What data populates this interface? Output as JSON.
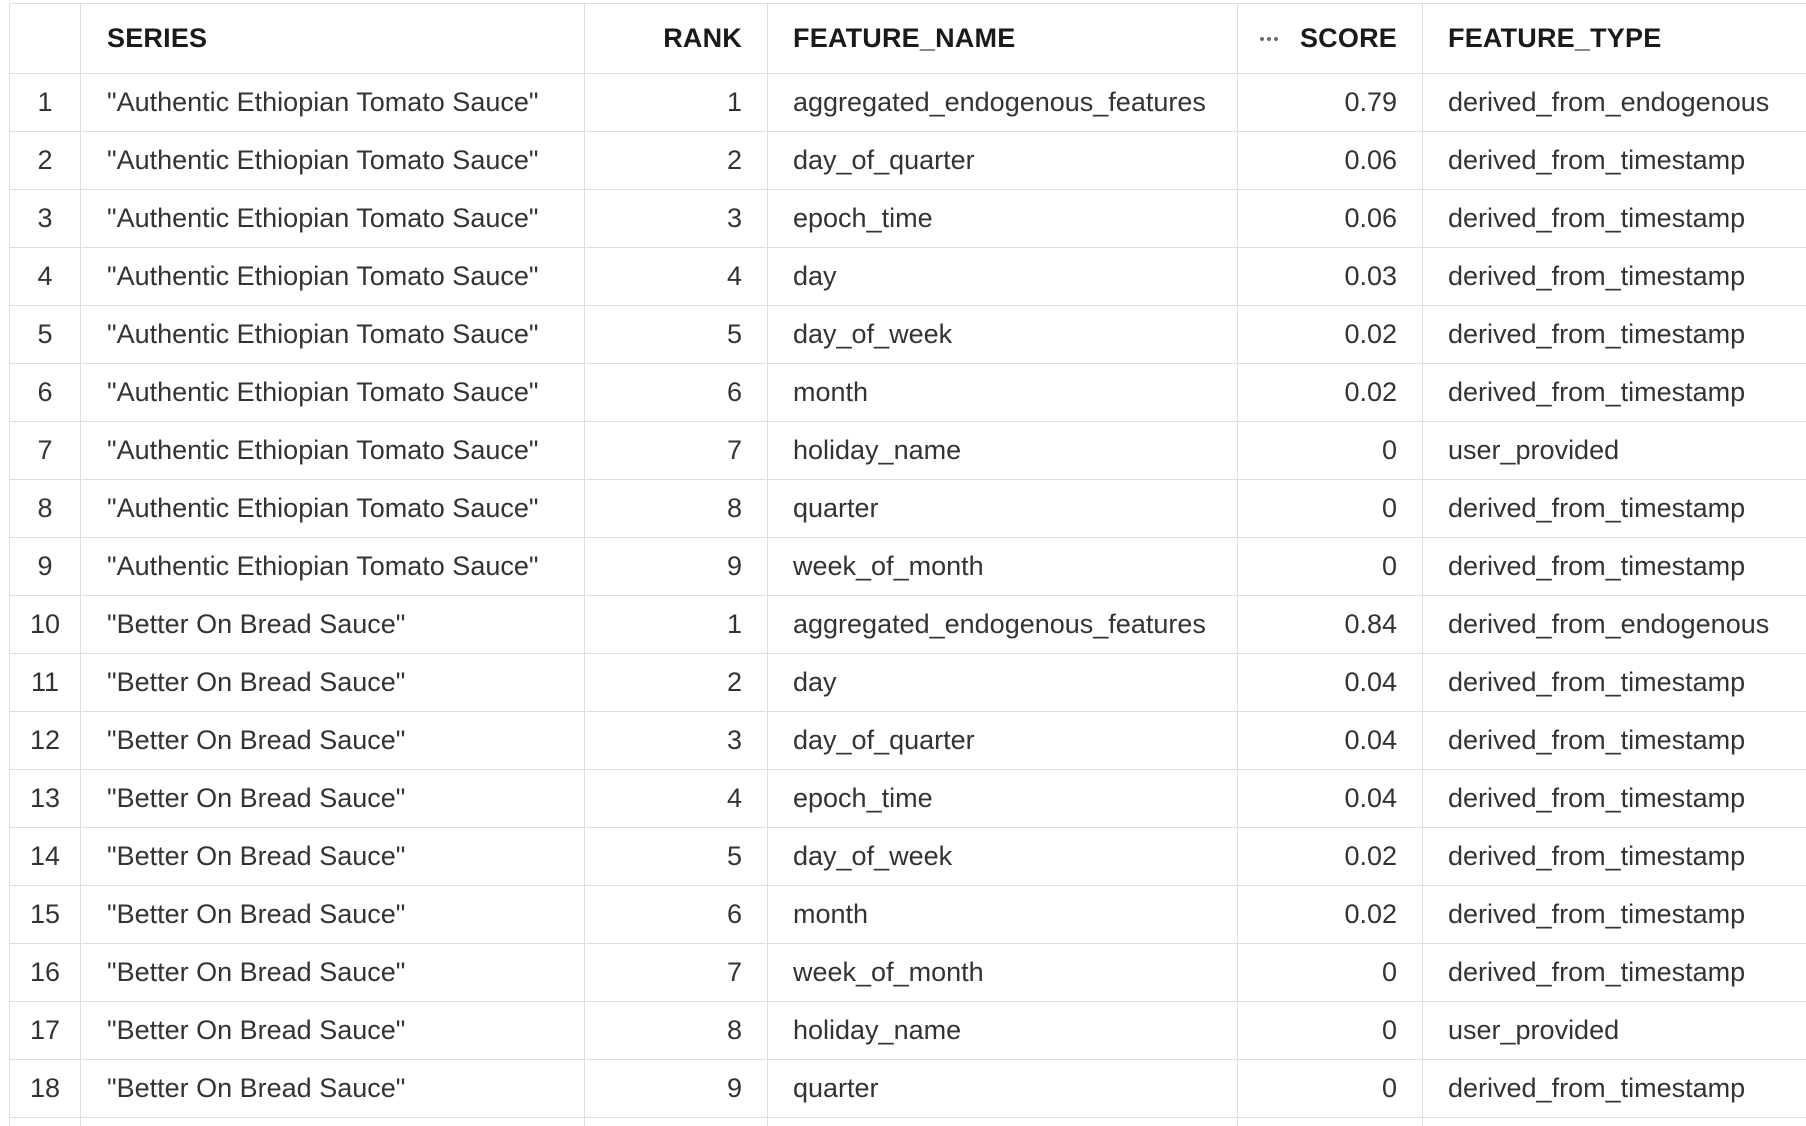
{
  "columns": {
    "index": "",
    "series": "SERIES",
    "rank": "RANK",
    "feature_name": "FEATURE_NAME",
    "score": "SCORE",
    "feature_type": "FEATURE_TYPE"
  },
  "icons": {
    "column_menu": "more-horizontal-icon"
  },
  "colors": {
    "border": "#dedede",
    "row_index_text": "#a0a0a0",
    "header_text": "#1a1a1a",
    "cell_text": "#333333"
  },
  "rows": [
    {
      "idx": "1",
      "series": "\"Authentic Ethiopian Tomato Sauce\"",
      "rank": "1",
      "feature_name": "aggregated_endogenous_features",
      "score": "0.79",
      "feature_type": "derived_from_endogenous"
    },
    {
      "idx": "2",
      "series": "\"Authentic Ethiopian Tomato Sauce\"",
      "rank": "2",
      "feature_name": "day_of_quarter",
      "score": "0.06",
      "feature_type": "derived_from_timestamp"
    },
    {
      "idx": "3",
      "series": "\"Authentic Ethiopian Tomato Sauce\"",
      "rank": "3",
      "feature_name": "epoch_time",
      "score": "0.06",
      "feature_type": "derived_from_timestamp"
    },
    {
      "idx": "4",
      "series": "\"Authentic Ethiopian Tomato Sauce\"",
      "rank": "4",
      "feature_name": "day",
      "score": "0.03",
      "feature_type": "derived_from_timestamp"
    },
    {
      "idx": "5",
      "series": "\"Authentic Ethiopian Tomato Sauce\"",
      "rank": "5",
      "feature_name": "day_of_week",
      "score": "0.02",
      "feature_type": "derived_from_timestamp"
    },
    {
      "idx": "6",
      "series": "\"Authentic Ethiopian Tomato Sauce\"",
      "rank": "6",
      "feature_name": "month",
      "score": "0.02",
      "feature_type": "derived_from_timestamp"
    },
    {
      "idx": "7",
      "series": "\"Authentic Ethiopian Tomato Sauce\"",
      "rank": "7",
      "feature_name": "holiday_name",
      "score": "0",
      "feature_type": "user_provided"
    },
    {
      "idx": "8",
      "series": "\"Authentic Ethiopian Tomato Sauce\"",
      "rank": "8",
      "feature_name": "quarter",
      "score": "0",
      "feature_type": "derived_from_timestamp"
    },
    {
      "idx": "9",
      "series": "\"Authentic Ethiopian Tomato Sauce\"",
      "rank": "9",
      "feature_name": "week_of_month",
      "score": "0",
      "feature_type": "derived_from_timestamp"
    },
    {
      "idx": "10",
      "series": "\"Better On Bread Sauce\"",
      "rank": "1",
      "feature_name": "aggregated_endogenous_features",
      "score": "0.84",
      "feature_type": "derived_from_endogenous"
    },
    {
      "idx": "11",
      "series": "\"Better On Bread Sauce\"",
      "rank": "2",
      "feature_name": "day",
      "score": "0.04",
      "feature_type": "derived_from_timestamp"
    },
    {
      "idx": "12",
      "series": "\"Better On Bread Sauce\"",
      "rank": "3",
      "feature_name": "day_of_quarter",
      "score": "0.04",
      "feature_type": "derived_from_timestamp"
    },
    {
      "idx": "13",
      "series": "\"Better On Bread Sauce\"",
      "rank": "4",
      "feature_name": "epoch_time",
      "score": "0.04",
      "feature_type": "derived_from_timestamp"
    },
    {
      "idx": "14",
      "series": "\"Better On Bread Sauce\"",
      "rank": "5",
      "feature_name": "day_of_week",
      "score": "0.02",
      "feature_type": "derived_from_timestamp"
    },
    {
      "idx": "15",
      "series": "\"Better On Bread Sauce\"",
      "rank": "6",
      "feature_name": "month",
      "score": "0.02",
      "feature_type": "derived_from_timestamp"
    },
    {
      "idx": "16",
      "series": "\"Better On Bread Sauce\"",
      "rank": "7",
      "feature_name": "week_of_month",
      "score": "0",
      "feature_type": "derived_from_timestamp"
    },
    {
      "idx": "17",
      "series": "\"Better On Bread Sauce\"",
      "rank": "8",
      "feature_name": "holiday_name",
      "score": "0",
      "feature_type": "user_provided"
    },
    {
      "idx": "18",
      "series": "\"Better On Bread Sauce\"",
      "rank": "9",
      "feature_name": "quarter",
      "score": "0",
      "feature_type": "derived_from_timestamp"
    },
    {
      "idx": "",
      "series": "",
      "rank": "",
      "feature_name": "",
      "score": "",
      "feature_type": ""
    }
  ]
}
